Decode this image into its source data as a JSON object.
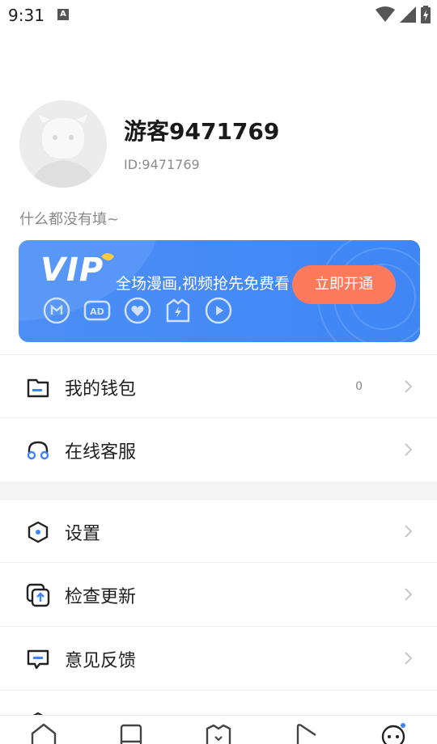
{
  "status": {
    "time": "9:31",
    "notif_letter": "A"
  },
  "profile": {
    "name": "游客9471769",
    "id_text": "ID:9471769",
    "bio": "什么都没有填~"
  },
  "vip": {
    "logo": "VIP",
    "text": "全场漫画,视频抢先免费看",
    "button": "立即开通"
  },
  "menu": {
    "wallet": {
      "label": "我的钱包",
      "value": "0"
    },
    "service": {
      "label": "在线客服"
    },
    "settings": {
      "label": "设置"
    },
    "update": {
      "label": "检查更新"
    },
    "feedback": {
      "label": "意见反馈"
    }
  },
  "colors": {
    "accent": "#3f86f5",
    "cta": "#ff7a5c"
  }
}
